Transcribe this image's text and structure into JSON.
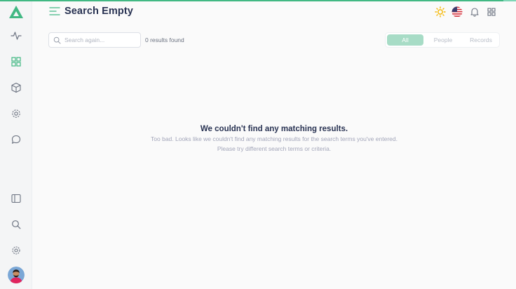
{
  "header": {
    "title": "Search Empty"
  },
  "search": {
    "placeholder": "Search again...",
    "value": "",
    "results_text": "0 results found"
  },
  "tabs": [
    {
      "label": "All",
      "active": true
    },
    {
      "label": "People",
      "active": false
    },
    {
      "label": "Records",
      "active": false
    }
  ],
  "empty_state": {
    "title": "We couldn't find any matching results.",
    "line1": "Too bad. Looks like we couldn't find any matching results for the search terms you've entered.",
    "line2": "Please try different search terms or criteria."
  },
  "sidebar": {
    "top_icons": [
      "activity-icon",
      "grid-icon",
      "box-icon",
      "settings-cog-icon",
      "message-icon"
    ],
    "bottom_icons": [
      "sidebar-panel-icon",
      "search-icon",
      "gear-icon"
    ]
  },
  "header_icons": [
    "sun-icon",
    "us-flag-icon",
    "bell-icon",
    "apps-grid-icon"
  ],
  "colors": {
    "accent": "#41b883",
    "active_tab": "#a7dcc6",
    "title": "#283252",
    "muted": "#a2a5b9"
  }
}
